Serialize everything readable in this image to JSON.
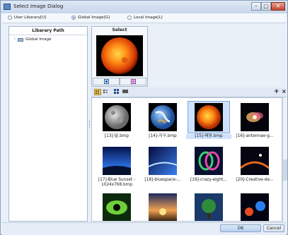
{
  "window": {
    "title": "Select Image Dialog",
    "controls": {
      "minimize": "–",
      "maximize": "□",
      "close": "✕"
    }
  },
  "radio_options": [
    {
      "label": "User Libarary[U]",
      "checked": false
    },
    {
      "label": "Global Image[G]",
      "checked": true
    },
    {
      "label": "Local Image[L]",
      "checked": false
    }
  ],
  "library_panel": {
    "header": "Libarary Path",
    "items": [
      {
        "label": "Global Image",
        "icon": "folder-icon"
      }
    ]
  },
  "select_panel": {
    "header": "Select",
    "image_icon": "sun-thumbnail"
  },
  "thumbnails": [
    {
      "caption": "[13]-달.bmp",
      "kind": "moon",
      "selected": false
    },
    {
      "caption": "[14]-지구.bmp",
      "kind": "earth",
      "selected": false
    },
    {
      "caption": "[15]-태양.bmp",
      "kind": "sun",
      "selected": true
    },
    {
      "caption": "[16]-antennae-g...",
      "kind": "galaxy",
      "selected": false
    },
    {
      "caption": "[17]-Blue Sunset -\n1024x768.bmp",
      "kind": "blue-sunset",
      "selected": false
    },
    {
      "caption": "[18]-bluespace-...",
      "kind": "bluespace",
      "selected": false
    },
    {
      "caption": "[19]-crazy-eight...",
      "kind": "crazy",
      "selected": false
    },
    {
      "caption": "[20]-Creative-de...",
      "kind": "creative",
      "selected": false
    },
    {
      "caption": "",
      "kind": "eye",
      "selected": false
    },
    {
      "caption": "",
      "kind": "sunrise",
      "selected": false
    },
    {
      "caption": "",
      "kind": "tree",
      "selected": false
    },
    {
      "caption": "",
      "kind": "space-orbs",
      "selected": false
    }
  ],
  "footer": {
    "ok_label": "OK",
    "cancel_label": "Cancel"
  }
}
